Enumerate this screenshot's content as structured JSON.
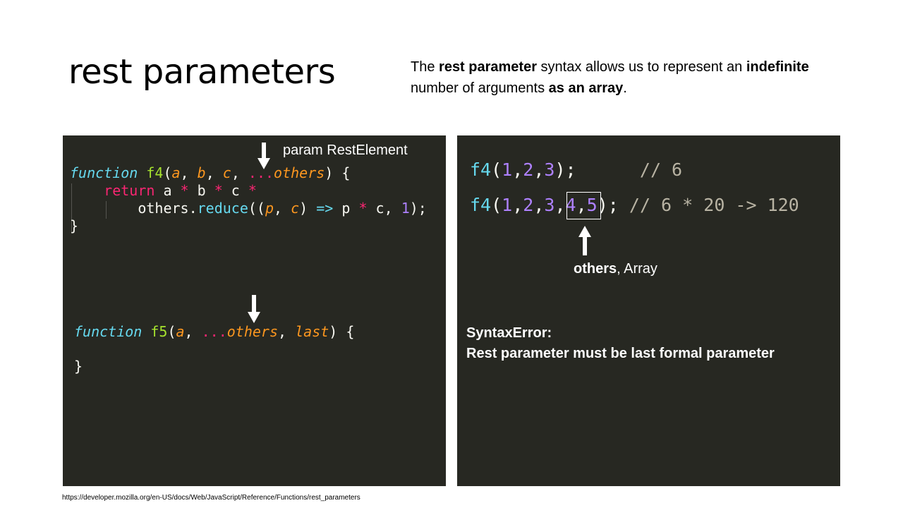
{
  "slide": {
    "title": "rest parameters",
    "description": {
      "p1": "The ",
      "b1": "rest parameter",
      "p2": " syntax allows us to represent an ",
      "b2": "indefinite",
      "p3": " number of arguments ",
      "b3": "as an array",
      "p4": "."
    },
    "footer_url": "https://developer.mozilla.org/en-US/docs/Web/JavaScript/Reference/Functions/rest_parameters"
  },
  "left_panel": {
    "annotation": "param RestElement",
    "f4": {
      "l1_kw": "function",
      "l1_name": " f4",
      "l1_open": "(",
      "l1_a": "a",
      "l1_c1": ", ",
      "l1_b": "b",
      "l1_c2": ", ",
      "l1_c": "c",
      "l1_c3": ", ",
      "l1_spread": "...",
      "l1_others": "others",
      "l1_close": ") {",
      "l2_return": "return",
      "l2_a": " a ",
      "l2_op1": "*",
      "l2_b": " b ",
      "l2_op2": "*",
      "l2_c": " c ",
      "l2_op3": "*",
      "l3_others": "others.",
      "l3_reduce": "reduce",
      "l3_open": "((",
      "l3_p": "p",
      "l3_comma": ", ",
      "l3_c": "c",
      "l3_paren": ") ",
      "l3_arrow": "=>",
      "l3_pexpr": " p ",
      "l3_op": "*",
      "l3_cexpr": " c, ",
      "l3_one": "1",
      "l3_end": ");",
      "l4": "}"
    },
    "f5": {
      "l1_kw": "function",
      "l1_name": " f5",
      "l1_open": "(",
      "l1_a": "a",
      "l1_c1": ", ",
      "l1_spread": "...",
      "l1_others": "others",
      "l1_c2": ", ",
      "l1_last": "last",
      "l1_close": ") {",
      "l2": "}"
    }
  },
  "right_panel": {
    "call1": {
      "name": "f4",
      "open": "(",
      "n1": "1",
      "c1": ",",
      "n2": "2",
      "c2": ",",
      "n3": "3",
      "close": ");",
      "comment": "// 6"
    },
    "call2": {
      "name": "f4",
      "open": "(",
      "n1": "1",
      "c1": ",",
      "n2": "2",
      "c2": ",",
      "n3": "3",
      "c3": ",",
      "n4": "4",
      "c4": ",",
      "n5": "5",
      "close": ");",
      "comment": "// 6 * 20 -> 120"
    },
    "annotation_bold": "others",
    "annotation_rest": ", Array",
    "error_line1": "SyntaxError:",
    "error_line2": "Rest parameter must be last formal parameter"
  }
}
